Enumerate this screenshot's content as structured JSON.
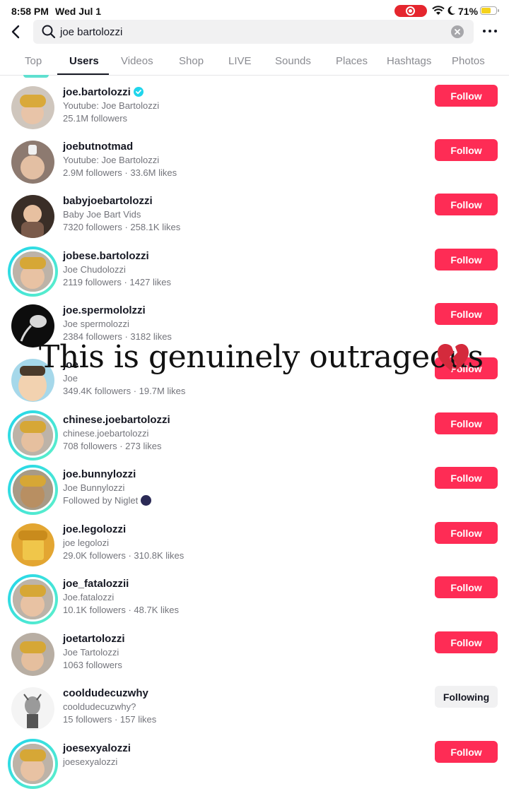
{
  "status_bar": {
    "time": "8:58 PM",
    "date": "Wed Jul 1",
    "battery": "71%",
    "battery_level": 0.71
  },
  "search": {
    "query": "joe bartolozzi"
  },
  "tabs": [
    {
      "label": "Top"
    },
    {
      "label": "Users"
    },
    {
      "label": "Videos"
    },
    {
      "label": "Shop"
    },
    {
      "label": "LIVE"
    },
    {
      "label": "Sounds"
    },
    {
      "label": "Places"
    },
    {
      "label": "Hashtags"
    },
    {
      "label": "Photos"
    }
  ],
  "active_tab": "Users",
  "overlay": {
    "caption": "This is genuinely outrageous",
    "emoji": "broken-heart"
  },
  "users": [
    {
      "username": "joe.bartolozzi",
      "verified": true,
      "subtitle": "Youtube: Joe Bartolozzi",
      "stats": "25.1M followers",
      "button": "Follow",
      "avatar_color": "#d8a85a"
    },
    {
      "username": "joebutnotmad",
      "subtitle": "Youtube: Joe Bartolozzi",
      "stats": "2.9M followers · 33.6M likes",
      "button": "Follow",
      "avatar_color": "#9a7a6a"
    },
    {
      "username": "babyjoebartolozzi",
      "subtitle": "Baby Joe Bart Vids",
      "stats": "7320 followers · 258.1K likes",
      "button": "Follow",
      "avatar_color": "#5b4a3c"
    },
    {
      "username": "jobese.bartolozzi",
      "subtitle": "Joe Chudolozzi",
      "stats": "2119 followers · 1427 likes",
      "button": "Follow",
      "avatar_color": "#c9a45a"
    },
    {
      "username": "joe.spermololzzi",
      "subtitle": "Joe spermolozzi",
      "stats": "2384 followers · 3182 likes",
      "button": "Follow",
      "avatar_color": "#111111"
    },
    {
      "username": "joe",
      "subtitle": "Joe",
      "stats": "349.4K followers · 19.7M likes",
      "button": "Follow",
      "avatar_color": "#9fd3e8"
    },
    {
      "username": "chinese.joebartolozzi",
      "subtitle": "chinese.joebartolozzi",
      "stats": "708 followers · 273 likes",
      "button": "Follow",
      "avatar_color": "#c9a45a"
    },
    {
      "username": "joe.bunnylozzi",
      "subtitle": "Joe Bunnylozzi",
      "stats": "Followed by Niglet",
      "button": "Follow",
      "avatar_color": "#b08a5a"
    },
    {
      "username": "joe.legolozzi",
      "subtitle": "joe legolozi",
      "stats": "29.0K followers · 310.8K likes",
      "button": "Follow",
      "avatar_color": "#e0a830"
    },
    {
      "username": "joe_fatalozzii",
      "subtitle": "Joe.fatalozzi",
      "stats": "10.1K followers · 48.7K likes",
      "button": "Follow",
      "avatar_color": "#c9a45a"
    },
    {
      "username": "joetartolozzi",
      "subtitle": "Joe Tartolozzi",
      "stats": "1063 followers",
      "button": "Follow",
      "avatar_color": "#c9a45a"
    },
    {
      "username": "cooldudecuzwhy",
      "subtitle": "cooldudecuzwhy?",
      "stats": "15 followers · 157 likes",
      "button": "Following",
      "avatar_color": "#e8e8e8"
    },
    {
      "username": "joesexyalozzi",
      "subtitle": "joesexyalozzi",
      "stats": "",
      "button": "Follow",
      "avatar_color": "#c9a45a"
    }
  ]
}
